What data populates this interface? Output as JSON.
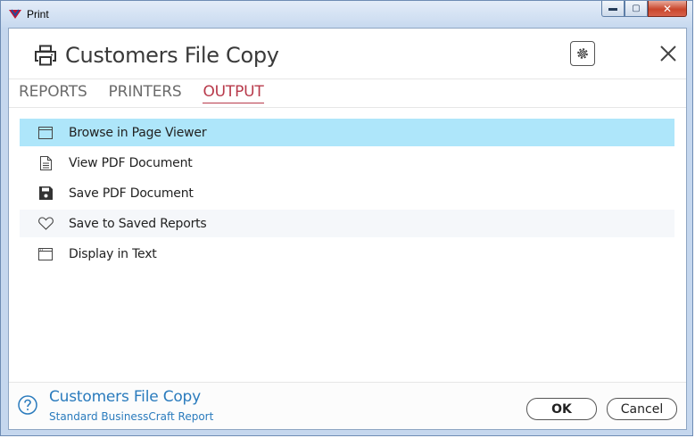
{
  "window": {
    "title": "Print",
    "controls": {
      "minimize": "▬",
      "maximize": "▢",
      "close": "✕"
    }
  },
  "header": {
    "title": "Customers File Copy",
    "icons": {
      "printer": "printer-icon",
      "settings": "gear-icon",
      "close": "close-icon"
    }
  },
  "tabs": [
    {
      "label": "REPORTS",
      "active": false
    },
    {
      "label": "PRINTERS",
      "active": false
    },
    {
      "label": "OUTPUT",
      "active": true
    }
  ],
  "output_options": [
    {
      "label": "Browse in Page Viewer",
      "icon": "window-icon",
      "state": "selected"
    },
    {
      "label": "View PDF Document",
      "icon": "document-icon",
      "state": "normal"
    },
    {
      "label": "Save PDF Document",
      "icon": "floppy-disk-icon",
      "state": "normal"
    },
    {
      "label": "Save to Saved Reports",
      "icon": "heart-icon",
      "state": "hover"
    },
    {
      "label": "Display in Text",
      "icon": "text-window-icon",
      "state": "normal"
    }
  ],
  "footer": {
    "title": "Customers File Copy",
    "subtitle": "Standard BusinessCraft Report",
    "ok_label": "OK",
    "cancel_label": "Cancel"
  },
  "colors": {
    "accent_tab": "#b83a4b",
    "selected_row": "#aee6fa",
    "footer_text": "#2a7bbd"
  }
}
